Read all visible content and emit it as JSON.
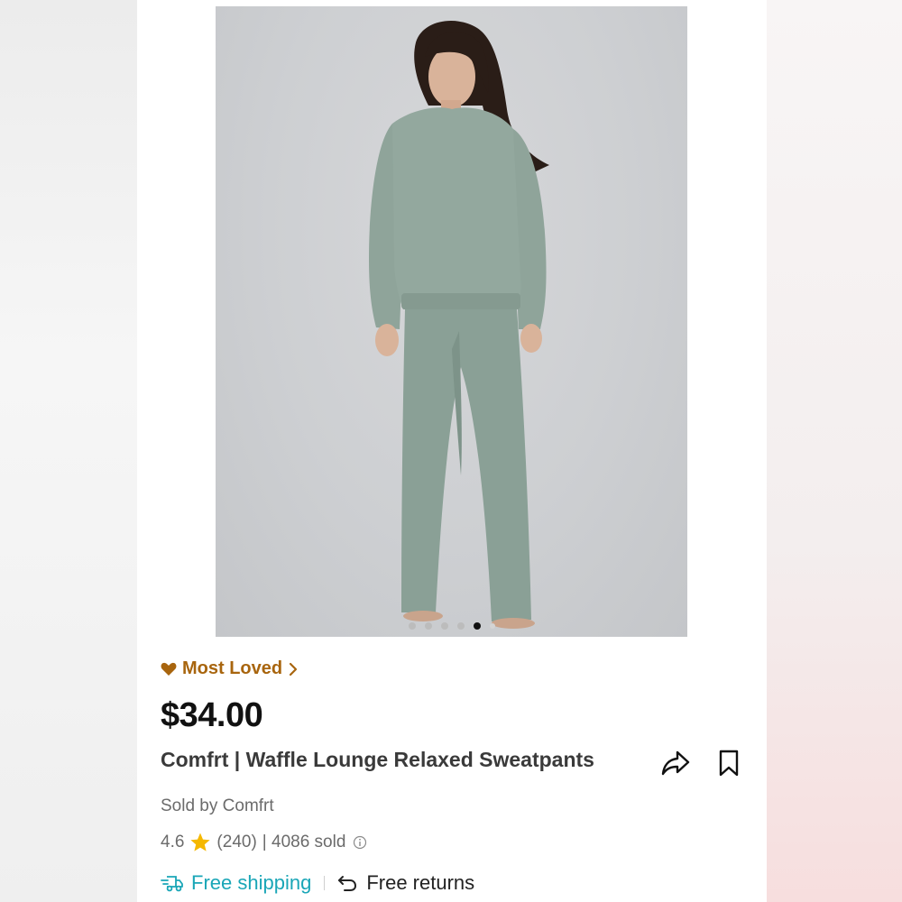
{
  "product": {
    "badge": "Most Loved",
    "price": "$34.00",
    "title": "Comfrt | Waffle Lounge Relaxed Sweatpants",
    "seller": "Sold by Comfrt",
    "rating": "4.6",
    "reviews": "(240)",
    "sold": "| 4086 sold",
    "free_shipping": "Free shipping",
    "free_returns": "Free returns"
  },
  "gallery": {
    "total_images": 6,
    "active_index": 5
  },
  "colors": {
    "badge": "#a8650e",
    "shipping": "#1aa6b7",
    "star": "#f5b800",
    "garment": "#8fa49a"
  }
}
